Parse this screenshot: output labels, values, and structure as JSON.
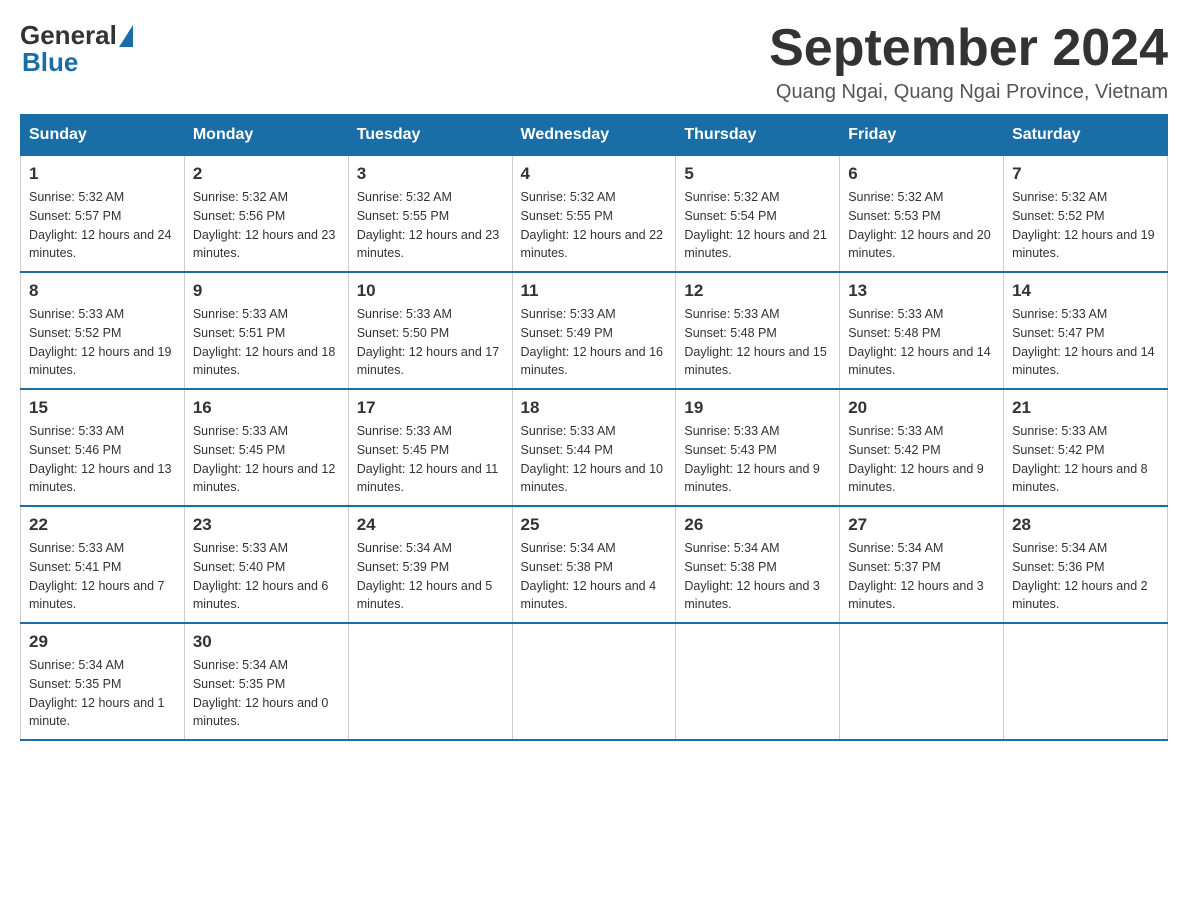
{
  "logo": {
    "general": "General",
    "blue": "Blue"
  },
  "title": "September 2024",
  "subtitle": "Quang Ngai, Quang Ngai Province, Vietnam",
  "days_of_week": [
    "Sunday",
    "Monday",
    "Tuesday",
    "Wednesday",
    "Thursday",
    "Friday",
    "Saturday"
  ],
  "weeks": [
    [
      {
        "day": "1",
        "sunrise": "Sunrise: 5:32 AM",
        "sunset": "Sunset: 5:57 PM",
        "daylight": "Daylight: 12 hours and 24 minutes."
      },
      {
        "day": "2",
        "sunrise": "Sunrise: 5:32 AM",
        "sunset": "Sunset: 5:56 PM",
        "daylight": "Daylight: 12 hours and 23 minutes."
      },
      {
        "day": "3",
        "sunrise": "Sunrise: 5:32 AM",
        "sunset": "Sunset: 5:55 PM",
        "daylight": "Daylight: 12 hours and 23 minutes."
      },
      {
        "day": "4",
        "sunrise": "Sunrise: 5:32 AM",
        "sunset": "Sunset: 5:55 PM",
        "daylight": "Daylight: 12 hours and 22 minutes."
      },
      {
        "day": "5",
        "sunrise": "Sunrise: 5:32 AM",
        "sunset": "Sunset: 5:54 PM",
        "daylight": "Daylight: 12 hours and 21 minutes."
      },
      {
        "day": "6",
        "sunrise": "Sunrise: 5:32 AM",
        "sunset": "Sunset: 5:53 PM",
        "daylight": "Daylight: 12 hours and 20 minutes."
      },
      {
        "day": "7",
        "sunrise": "Sunrise: 5:32 AM",
        "sunset": "Sunset: 5:52 PM",
        "daylight": "Daylight: 12 hours and 19 minutes."
      }
    ],
    [
      {
        "day": "8",
        "sunrise": "Sunrise: 5:33 AM",
        "sunset": "Sunset: 5:52 PM",
        "daylight": "Daylight: 12 hours and 19 minutes."
      },
      {
        "day": "9",
        "sunrise": "Sunrise: 5:33 AM",
        "sunset": "Sunset: 5:51 PM",
        "daylight": "Daylight: 12 hours and 18 minutes."
      },
      {
        "day": "10",
        "sunrise": "Sunrise: 5:33 AM",
        "sunset": "Sunset: 5:50 PM",
        "daylight": "Daylight: 12 hours and 17 minutes."
      },
      {
        "day": "11",
        "sunrise": "Sunrise: 5:33 AM",
        "sunset": "Sunset: 5:49 PM",
        "daylight": "Daylight: 12 hours and 16 minutes."
      },
      {
        "day": "12",
        "sunrise": "Sunrise: 5:33 AM",
        "sunset": "Sunset: 5:48 PM",
        "daylight": "Daylight: 12 hours and 15 minutes."
      },
      {
        "day": "13",
        "sunrise": "Sunrise: 5:33 AM",
        "sunset": "Sunset: 5:48 PM",
        "daylight": "Daylight: 12 hours and 14 minutes."
      },
      {
        "day": "14",
        "sunrise": "Sunrise: 5:33 AM",
        "sunset": "Sunset: 5:47 PM",
        "daylight": "Daylight: 12 hours and 14 minutes."
      }
    ],
    [
      {
        "day": "15",
        "sunrise": "Sunrise: 5:33 AM",
        "sunset": "Sunset: 5:46 PM",
        "daylight": "Daylight: 12 hours and 13 minutes."
      },
      {
        "day": "16",
        "sunrise": "Sunrise: 5:33 AM",
        "sunset": "Sunset: 5:45 PM",
        "daylight": "Daylight: 12 hours and 12 minutes."
      },
      {
        "day": "17",
        "sunrise": "Sunrise: 5:33 AM",
        "sunset": "Sunset: 5:45 PM",
        "daylight": "Daylight: 12 hours and 11 minutes."
      },
      {
        "day": "18",
        "sunrise": "Sunrise: 5:33 AM",
        "sunset": "Sunset: 5:44 PM",
        "daylight": "Daylight: 12 hours and 10 minutes."
      },
      {
        "day": "19",
        "sunrise": "Sunrise: 5:33 AM",
        "sunset": "Sunset: 5:43 PM",
        "daylight": "Daylight: 12 hours and 9 minutes."
      },
      {
        "day": "20",
        "sunrise": "Sunrise: 5:33 AM",
        "sunset": "Sunset: 5:42 PM",
        "daylight": "Daylight: 12 hours and 9 minutes."
      },
      {
        "day": "21",
        "sunrise": "Sunrise: 5:33 AM",
        "sunset": "Sunset: 5:42 PM",
        "daylight": "Daylight: 12 hours and 8 minutes."
      }
    ],
    [
      {
        "day": "22",
        "sunrise": "Sunrise: 5:33 AM",
        "sunset": "Sunset: 5:41 PM",
        "daylight": "Daylight: 12 hours and 7 minutes."
      },
      {
        "day": "23",
        "sunrise": "Sunrise: 5:33 AM",
        "sunset": "Sunset: 5:40 PM",
        "daylight": "Daylight: 12 hours and 6 minutes."
      },
      {
        "day": "24",
        "sunrise": "Sunrise: 5:34 AM",
        "sunset": "Sunset: 5:39 PM",
        "daylight": "Daylight: 12 hours and 5 minutes."
      },
      {
        "day": "25",
        "sunrise": "Sunrise: 5:34 AM",
        "sunset": "Sunset: 5:38 PM",
        "daylight": "Daylight: 12 hours and 4 minutes."
      },
      {
        "day": "26",
        "sunrise": "Sunrise: 5:34 AM",
        "sunset": "Sunset: 5:38 PM",
        "daylight": "Daylight: 12 hours and 3 minutes."
      },
      {
        "day": "27",
        "sunrise": "Sunrise: 5:34 AM",
        "sunset": "Sunset: 5:37 PM",
        "daylight": "Daylight: 12 hours and 3 minutes."
      },
      {
        "day": "28",
        "sunrise": "Sunrise: 5:34 AM",
        "sunset": "Sunset: 5:36 PM",
        "daylight": "Daylight: 12 hours and 2 minutes."
      }
    ],
    [
      {
        "day": "29",
        "sunrise": "Sunrise: 5:34 AM",
        "sunset": "Sunset: 5:35 PM",
        "daylight": "Daylight: 12 hours and 1 minute."
      },
      {
        "day": "30",
        "sunrise": "Sunrise: 5:34 AM",
        "sunset": "Sunset: 5:35 PM",
        "daylight": "Daylight: 12 hours and 0 minutes."
      },
      null,
      null,
      null,
      null,
      null
    ]
  ]
}
